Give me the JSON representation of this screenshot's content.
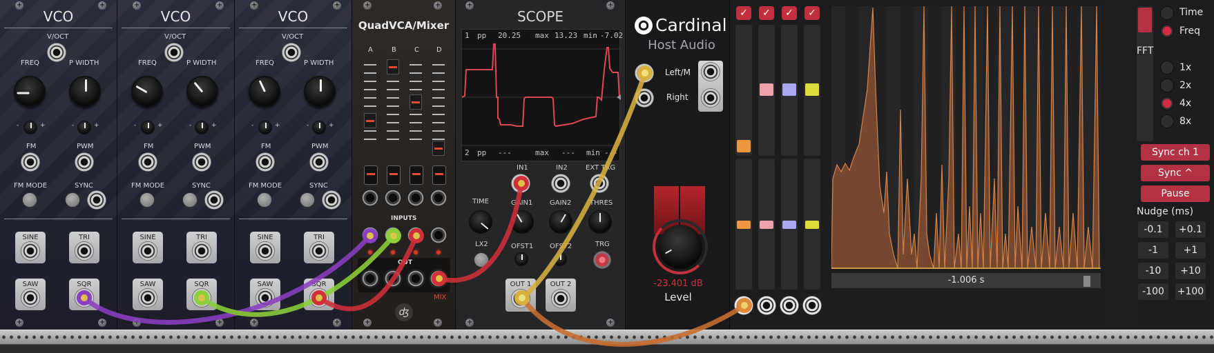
{
  "colors": {
    "accent_red": "#b23243",
    "cable_purple": "#8a3fc0",
    "cable_green": "#8ccf3a",
    "cable_red": "#d0303a",
    "cable_yellow": "#d8b040",
    "cable_orange": "#c86e30",
    "scope_trace": "#e0485a",
    "spectrum_fill": "#e08a4a"
  },
  "vco": {
    "title": "VCO",
    "voct": "V/OCT",
    "freq": "FREQ",
    "pwidth": "P WIDTH",
    "minus": "-",
    "plus": "+",
    "fm": "FM",
    "pwm": "PWM",
    "fm_mode": "FM MODE",
    "sync": "SYNC",
    "sine": "SINE",
    "tri": "TRI",
    "saw": "SAW",
    "sqr": "SQR"
  },
  "qvca": {
    "title": "QuadVCA/Mixer",
    "channels": [
      "A",
      "B",
      "C",
      "D"
    ],
    "inputs": "INPUTS",
    "out": "OUT",
    "mix": "MIX"
  },
  "scope": {
    "title": "SCOPE",
    "ch1": {
      "num": "1",
      "pp": "pp",
      "pp_val": "20.25",
      "max": "max",
      "max_val": "13.23",
      "min": "min",
      "min_val": "-7.02"
    },
    "ch2": {
      "num": "2",
      "pp": "pp",
      "pp_val": "---",
      "max": "max",
      "max_val": "---",
      "min": "min",
      "min_val": "---"
    },
    "in1": "IN1",
    "in2": "IN2",
    "ext_trg": "EXT TRG",
    "time": "TIME",
    "gain1": "GAIN1",
    "gain2": "GAIN2",
    "thres": "THRES",
    "lx2": "LX2",
    "ofst1": "OFST1",
    "ofst2": "OFST2",
    "trg": "TRG",
    "out1": "OUT 1",
    "out2": "OUT 2"
  },
  "cardinal": {
    "brand": "Cardinal",
    "subtitle": "Host Audio",
    "left": "Left/M",
    "right": "Right",
    "level_db": "-23.401 dB",
    "level_label": "Level"
  },
  "spectrum": {
    "time_readout": "-1.006 s"
  },
  "controls": {
    "time": "Time",
    "freq": "Freq",
    "mode_selected": "Freq",
    "fft": "FFT",
    "fft_options": [
      "1x",
      "2x",
      "4x",
      "8x"
    ],
    "fft_selected": "4x",
    "sync_ch1": "Sync ch 1",
    "sync": "Sync ^",
    "pause": "Pause",
    "nudge": "Nudge (ms)",
    "nudge_buttons": [
      "-0.1",
      "+0.1",
      "-1",
      "+1",
      "-10",
      "+10",
      "-100",
      "+100"
    ]
  }
}
